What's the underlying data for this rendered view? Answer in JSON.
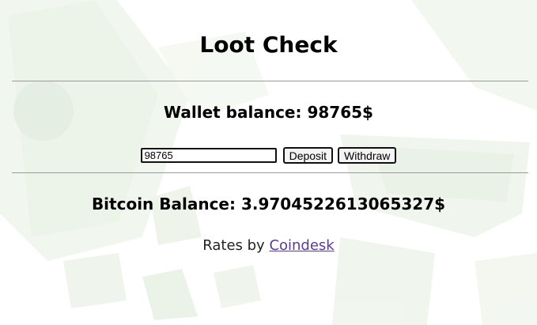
{
  "title": "Loot Check",
  "wallet": {
    "label": "Wallet balance: 98765$"
  },
  "form": {
    "amount_value": "98765",
    "deposit_label": "Deposit",
    "withdraw_label": "Withdraw"
  },
  "bitcoin": {
    "label": "Bitcoin Balance: 3.9704522613065327$"
  },
  "rates": {
    "prefix": "Rates by ",
    "link_label": "Coindesk"
  },
  "colors": {
    "link": "#5a3e8c",
    "rule": "#9a9a9a",
    "money_green": "#cfe3c5"
  },
  "background": {
    "image": "flying-money-banknotes"
  }
}
